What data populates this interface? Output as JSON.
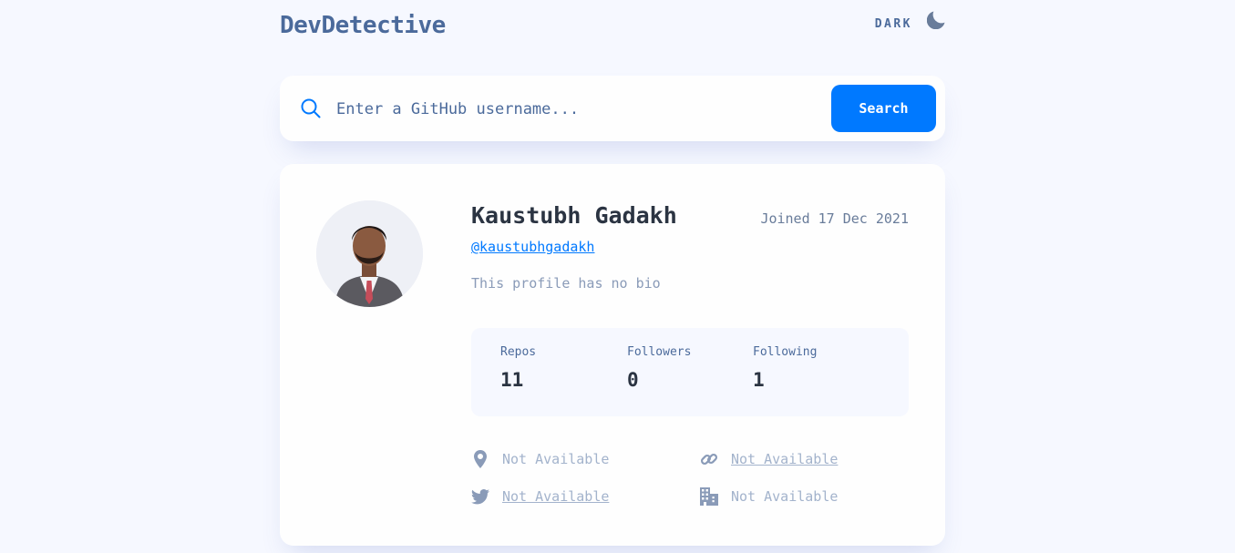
{
  "header": {
    "logo": "DevDetective",
    "theme_label": "DARK",
    "theme_icon": "moon-icon"
  },
  "search": {
    "placeholder": "Enter a GitHub username...",
    "value": "",
    "button_label": "Search",
    "icon": "search-icon"
  },
  "profile": {
    "name": "Kaustubh Gadakh",
    "joined": "Joined 17 Dec 2021",
    "login": "@kaustubhgadakh",
    "bio": "This profile has no bio",
    "stats": [
      {
        "label": "Repos",
        "value": "11"
      },
      {
        "label": "Followers",
        "value": "0"
      },
      {
        "label": "Following",
        "value": "1"
      }
    ],
    "links": {
      "location": {
        "text": "Not Available",
        "icon": "location-pin-icon"
      },
      "website": {
        "text": "Not Available",
        "icon": "link-icon"
      },
      "twitter": {
        "text": "Not Available",
        "icon": "twitter-icon"
      },
      "company": {
        "text": "Not Available",
        "icon": "building-icon"
      }
    }
  },
  "colors": {
    "accent": "#0079ff",
    "background": "#f6f8ff",
    "card": "#fefefe",
    "muted": "#a3b3cc",
    "text_dark": "#2b3442"
  }
}
